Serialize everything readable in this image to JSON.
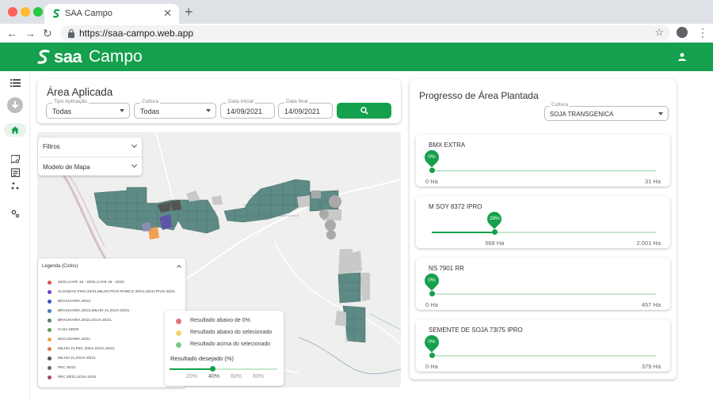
{
  "browser": {
    "tab_title": "SAA Campo",
    "close_glyph": "✕",
    "newtab_glyph": "+",
    "url": "https://saa-campo.web.app",
    "back_glyph": "←",
    "forward_glyph": "→",
    "reload_glyph": "↻",
    "star_glyph": "☆",
    "menu_glyph": "⋮",
    "dot_colors": [
      "#fe5f57",
      "#febc2e",
      "#28c840"
    ]
  },
  "app": {
    "logo_bold": "saa",
    "logo_light": "Campo",
    "brand_color": "#14a04c"
  },
  "sidebar": {
    "items": [
      {
        "icon": "menu-icon"
      },
      {
        "icon": "download-icon"
      },
      {
        "icon": "home-icon"
      },
      {
        "icon": "map-search-icon"
      },
      {
        "icon": "report-icon"
      },
      {
        "icon": "scatter-icon"
      },
      {
        "icon": "settings-icon"
      }
    ]
  },
  "filters": {
    "title": "Área Aplicada",
    "tipo_label": "Tipo Aplicação",
    "tipo_value": "Todas",
    "cultura_label": "Cultura",
    "cultura_value": "Todas",
    "data_inicial_label": "Data inicial",
    "data_inicial_value": "14/09/2021",
    "data_final_label": "Data final",
    "data_final_value": "14/09/2021"
  },
  "map": {
    "filtros_label": "Filtros",
    "modelo_label": "Modelo de Mapa",
    "legend_title": "Legenda (Ciclos)",
    "legend_items": [
      {
        "label": "20/21,CAFE 18 - 20/21,CAFE 19 - 20/21",
        "color": "#d9534f"
      },
      {
        "label": "ALGODAO PIVO 20/21,MILHO PIVO,PAINCO 20/21,SOJA PIVO 20/21",
        "color": "#6f42c1"
      },
      {
        "label": "BRACHIARIA 20/21",
        "color": "#3f51b5"
      },
      {
        "label": "BRACHIARIA 20/21,MILHO 21,SOJA 20/21",
        "color": "#3f7fbf"
      },
      {
        "label": "BRACHIARIA 20/21,SOJA 20/21",
        "color": "#5b7d70"
      },
      {
        "label": "CASA SEDE",
        "color": "#5c9b57"
      },
      {
        "label": "MACADAMIA 20/21",
        "color": "#f0a050"
      },
      {
        "label": "MILHO 21,PEC 20/21,SOJA 20/21",
        "color": "#e07b39"
      },
      {
        "label": "MILHO 21,SOJA 20/21",
        "color": "#555555"
      },
      {
        "label": "PEC 20/21",
        "color": "#666666"
      },
      {
        "label": "PEC 20/21,SOJA 20/21",
        "color": "#b0436f"
      }
    ],
    "result_items": [
      {
        "label": "Resultado abaixo de 0%",
        "color": "#e57373"
      },
      {
        "label": "Resultado abaixo do selecionado",
        "color": "#f6d36b"
      },
      {
        "label": "Resultado acima do selecionado",
        "color": "#81c784"
      }
    ],
    "result_title": "Resultado desejado (%)",
    "result_selected": 0.4,
    "result_ticks": [
      "20%",
      "40%",
      "60%",
      "80%"
    ]
  },
  "progress": {
    "title": "Progresso de Área Plantada",
    "cultura_label": "Cultura",
    "cultura_value": "SOJA TRANSGENICA",
    "varieties": [
      {
        "name": "BMX EXTRA",
        "pct_label": "0%",
        "fraction": 0.0,
        "low": "0 Ha",
        "high": "31 Ha"
      },
      {
        "name": "M SOY 8372 IPRO",
        "pct_label": "28%",
        "fraction": 0.28,
        "low": "568 Ha",
        "high": "2.001 Ha"
      },
      {
        "name": "NS 7901 RR",
        "pct_label": "0%",
        "fraction": 0.0,
        "low": "0 Ha",
        "high": "457 Ha"
      },
      {
        "name": "SEMENTE DE SOJA 73I75 IPRO",
        "pct_label": "0%",
        "fraction": 0.0,
        "low": "0 Ha",
        "high": "379 Ha"
      }
    ]
  }
}
